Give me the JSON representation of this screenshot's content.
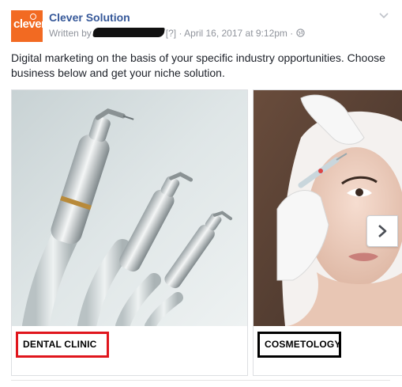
{
  "post": {
    "page_name": "Clever Solution",
    "logo_text": "clever",
    "meta": {
      "written_by": "Written by",
      "qmark": "[?]",
      "separator": "·",
      "date": "April 16, 2017 at 9:12pm",
      "separator2": "·",
      "audience_icon": "globe-icon"
    },
    "body": "Digital marketing on the basis of your specific industry opportunities. Choose business below and get your niche solution."
  },
  "carousel": {
    "cards": [
      {
        "caption": "DENTAL CLINIC",
        "image": "dental-instruments",
        "highlight": "#e0161d"
      },
      {
        "caption": "COSMETOLOGY",
        "image": "cosmetology-injection",
        "highlight": "#000000"
      }
    ],
    "next_icon": "chevron-right-icon"
  },
  "colors": {
    "link": "#365899",
    "meta": "#90949c",
    "logo_bg": "#f26a22"
  }
}
